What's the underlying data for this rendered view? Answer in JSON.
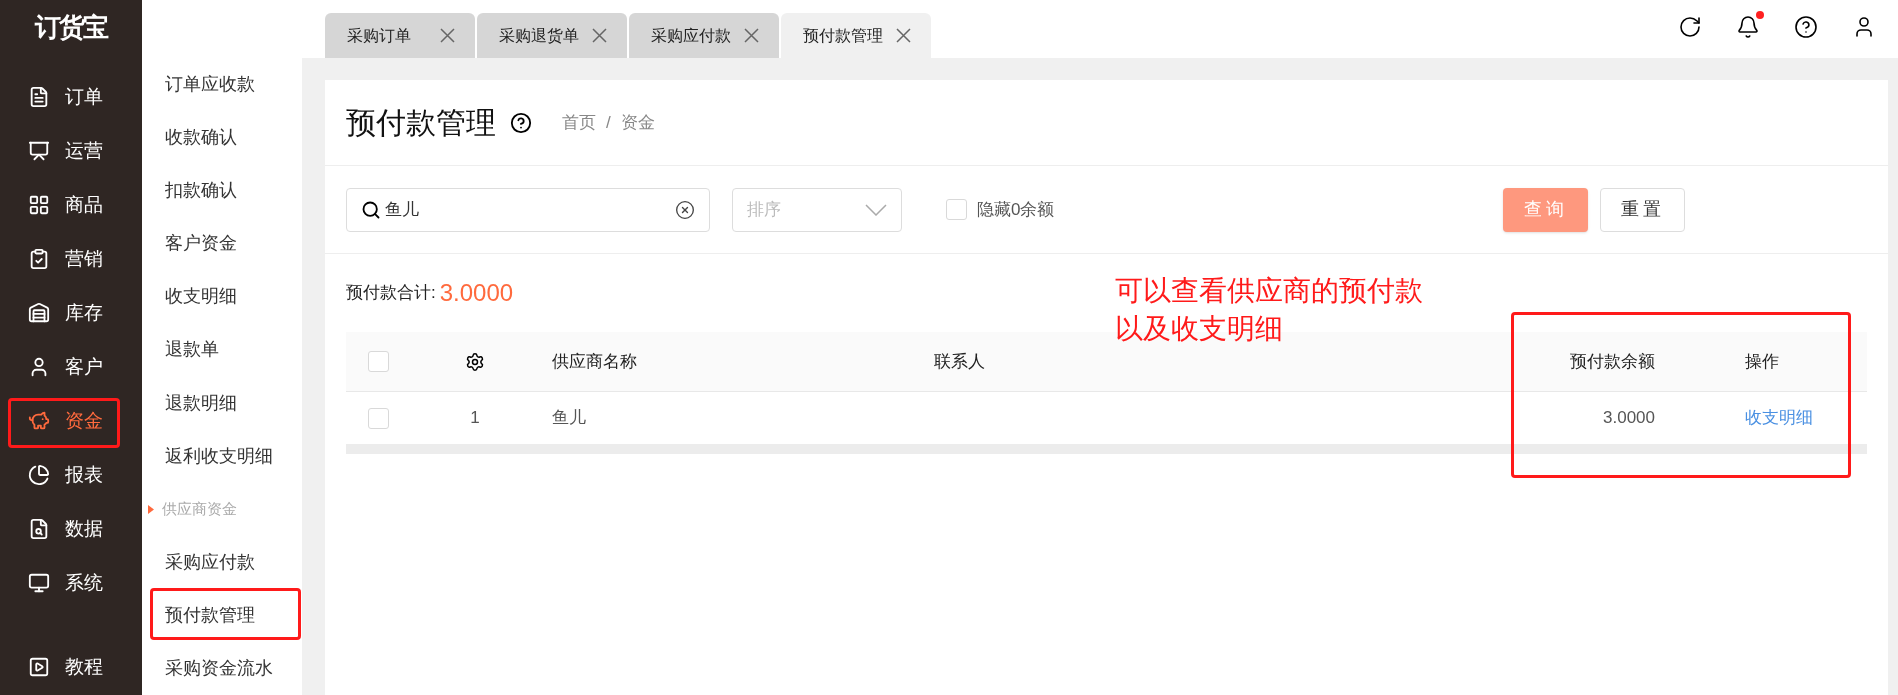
{
  "logo": "订货宝",
  "nav": [
    {
      "label": "订单",
      "selected": false
    },
    {
      "label": "运营",
      "selected": false
    },
    {
      "label": "商品",
      "selected": false
    },
    {
      "label": "营销",
      "selected": false
    },
    {
      "label": "库存",
      "selected": false
    },
    {
      "label": "客户",
      "selected": false
    },
    {
      "label": "资金",
      "selected": true
    },
    {
      "label": "报表",
      "selected": false
    },
    {
      "label": "数据",
      "selected": false
    },
    {
      "label": "系统",
      "selected": false
    },
    {
      "label": "教程",
      "selected": false,
      "kind": "footer"
    }
  ],
  "subnav": [
    {
      "kind": "item",
      "label": "订单应收款"
    },
    {
      "kind": "item",
      "label": "收款确认"
    },
    {
      "kind": "item",
      "label": "扣款确认"
    },
    {
      "kind": "item",
      "label": "客户资金"
    },
    {
      "kind": "item",
      "label": "收支明细"
    },
    {
      "kind": "item",
      "label": "退款单"
    },
    {
      "kind": "item",
      "label": "退款明细"
    },
    {
      "kind": "item",
      "label": "返利收支明细"
    },
    {
      "kind": "section",
      "label": "供应商资金"
    },
    {
      "kind": "item",
      "label": "采购应付款"
    },
    {
      "kind": "item",
      "label": "预付款管理"
    },
    {
      "kind": "item",
      "label": "采购资金流水"
    }
  ],
  "tabs": [
    {
      "label": "采购订单",
      "selected": false
    },
    {
      "label": "采购退货单",
      "selected": false
    },
    {
      "label": "采购应付款",
      "selected": false
    },
    {
      "label": "预付款管理",
      "selected": true
    }
  ],
  "page": {
    "title": "预付款管理",
    "breadcrumb": [
      "首页",
      "资金"
    ],
    "breadcrumb_separator": "/"
  },
  "filters": {
    "search": "鱼儿",
    "sort_placeholder": "排序",
    "hide_zero": {
      "label": "隐藏0余额",
      "checked": false
    },
    "buttons": [
      "查询",
      "重置"
    ]
  },
  "total": {
    "label": "预付款合计:",
    "value": "3.0000"
  },
  "annotation": [
    "可以查看供应商的预付款",
    "以及收支明细"
  ],
  "table": {
    "header_checked": false,
    "columns": [
      "供应商名称",
      "联系人",
      "预付款余额",
      "操作"
    ],
    "rows": [
      {
        "checked": false,
        "index": "1",
        "name": "鱼儿",
        "balance": "3.0000",
        "action": "收支明细"
      }
    ]
  }
}
